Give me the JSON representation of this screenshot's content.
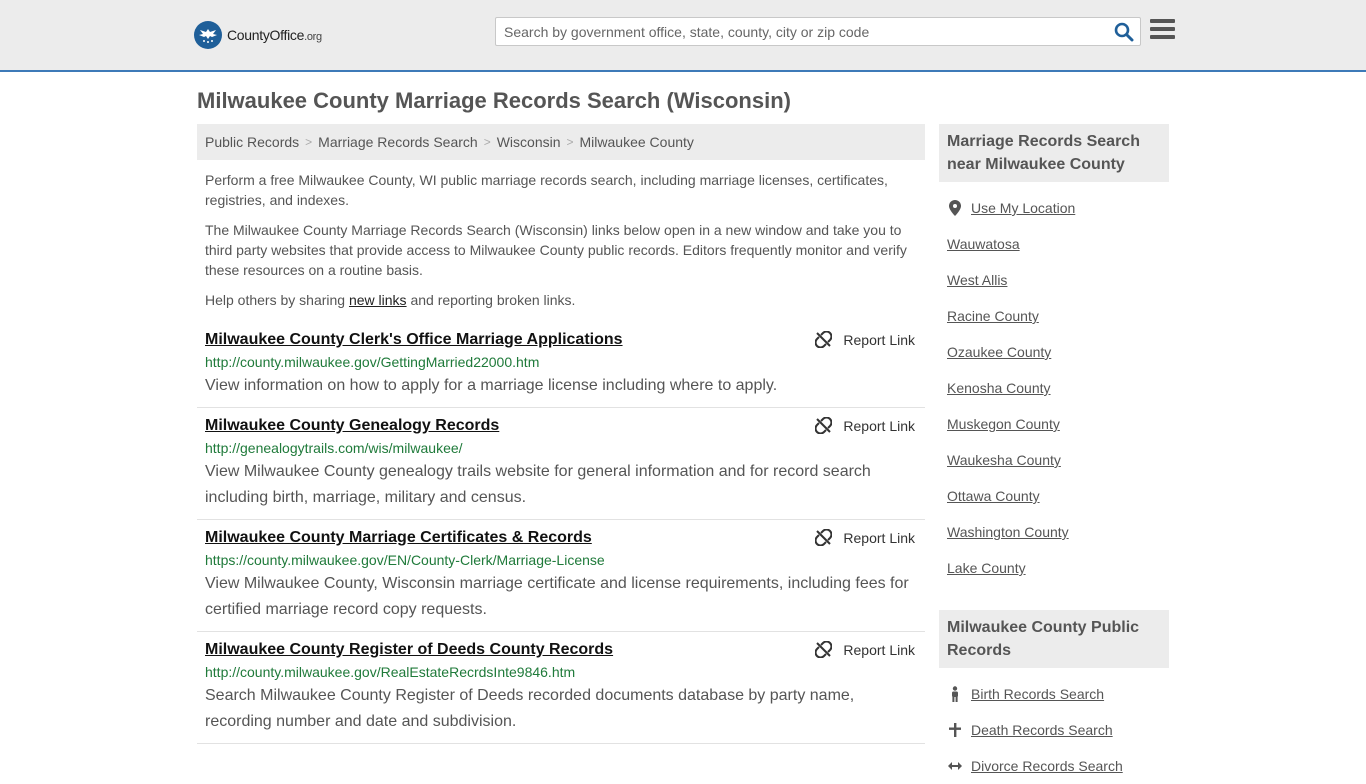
{
  "header": {
    "logo_main": "CountyOffice",
    "logo_suffix": ".org",
    "search_placeholder": "Search by government office, state, county, city or zip code"
  },
  "page_title": "Milwaukee County Marriage Records Search (Wisconsin)",
  "breadcrumb": [
    "Public Records",
    "Marriage Records Search",
    "Wisconsin",
    "Milwaukee County"
  ],
  "breadcrumb_separator": ">",
  "intro": {
    "p1": "Perform a free Milwaukee County, WI public marriage records search, including marriage licenses, certificates, registries, and indexes.",
    "p2": "The Milwaukee County Marriage Records Search (Wisconsin) links below open in a new window and take you to third party websites that provide access to Milwaukee County public records. Editors frequently monitor and verify these resources on a routine basis.",
    "p3_before": "Help others by sharing ",
    "p3_link": "new links",
    "p3_after": " and reporting broken links."
  },
  "report_label": "Report Link",
  "results": [
    {
      "title": "Milwaukee County Clerk's Office Marriage Applications",
      "url": "http://county.milwaukee.gov/GettingMarried22000.htm",
      "desc": "View information on how to apply for a marriage license including where to apply."
    },
    {
      "title": "Milwaukee County Genealogy Records",
      "url": "http://genealogytrails.com/wis/milwaukee/",
      "desc": "View Milwaukee County genealogy trails website for general information and for record search including birth, marriage, military and census."
    },
    {
      "title": "Milwaukee County Marriage Certificates & Records",
      "url": "https://county.milwaukee.gov/EN/County-Clerk/Marriage-License",
      "desc": "View Milwaukee County, Wisconsin marriage certificate and license requirements, including fees for certified marriage record copy requests."
    },
    {
      "title": "Milwaukee County Register of Deeds County Records",
      "url": "http://county.milwaukee.gov/RealEstateRecrdsInte9846.htm",
      "desc": "Search Milwaukee County Register of Deeds recorded documents database by party name, recording number and date and subdivision."
    }
  ],
  "sidebar": {
    "nearby_heading": "Marriage Records Search near Milwaukee County",
    "use_location": "Use My Location",
    "nearby": [
      "Wauwatosa",
      "West Allis",
      "Racine County",
      "Ozaukee County",
      "Kenosha County",
      "Muskegon County",
      "Waukesha County",
      "Ottawa County",
      "Washington County",
      "Lake County"
    ],
    "public_heading": "Milwaukee County Public Records",
    "public_links": [
      {
        "label": "Birth Records Search",
        "icon": "person-icon"
      },
      {
        "label": "Death Records Search",
        "icon": "cross-icon"
      },
      {
        "label": "Divorce Records Search",
        "icon": "arrows-icon"
      }
    ]
  },
  "colors": {
    "header_bg": "#ececec",
    "header_border": "#3d7ab8",
    "url_green": "#1f7a3a",
    "search_icon": "#1f5f99"
  }
}
